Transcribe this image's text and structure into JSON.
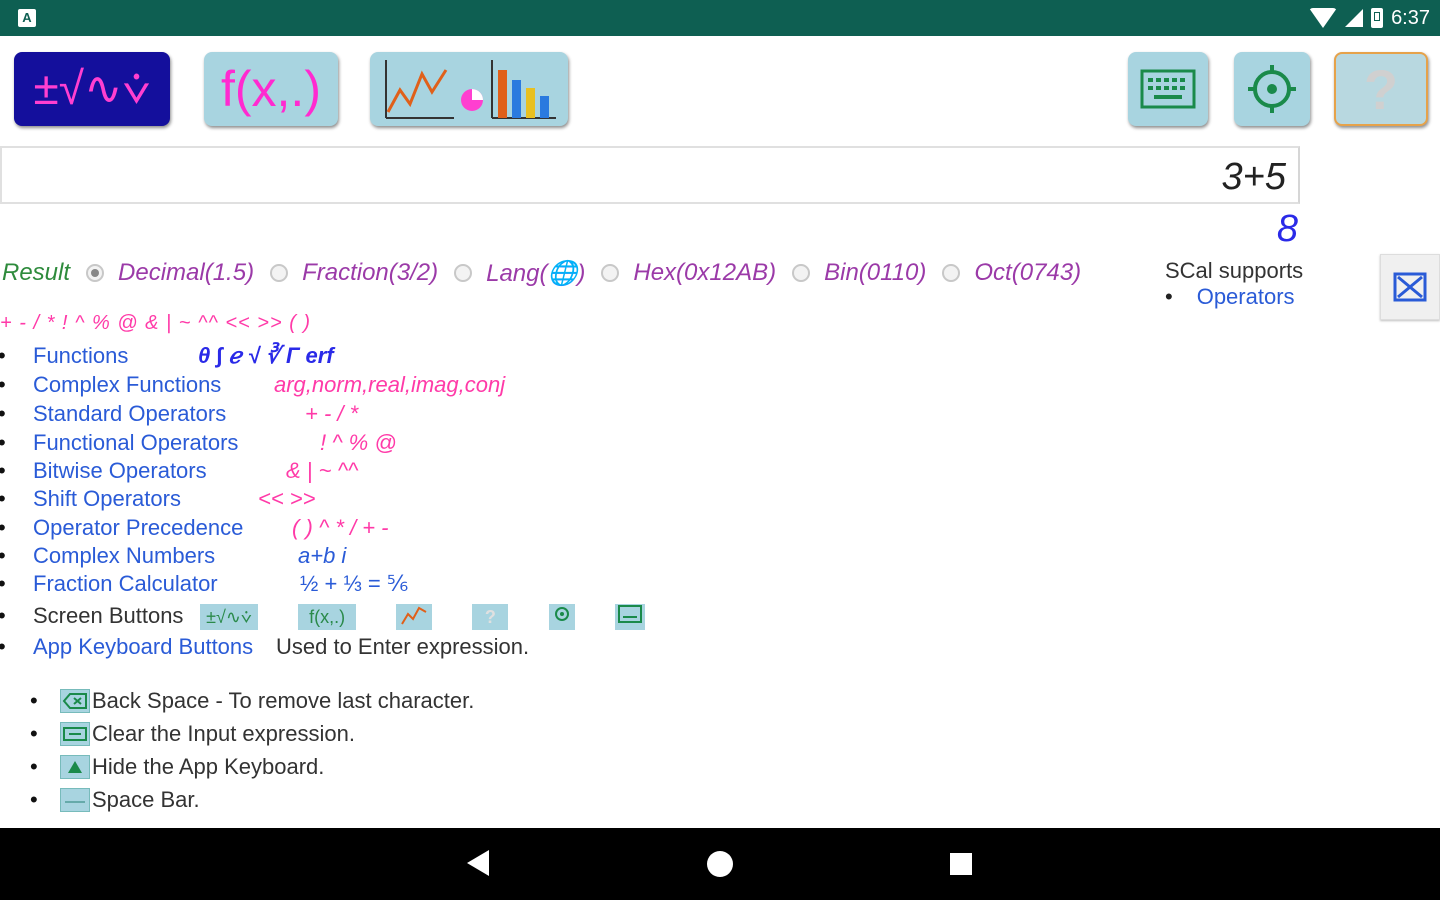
{
  "status": {
    "time": "6:37"
  },
  "toolbar": {
    "math_label": "±√∿⩒",
    "func_label": "f(x,.)",
    "help_label": "?"
  },
  "input": {
    "expression": "3+5"
  },
  "result": {
    "value": "8",
    "label": "Result",
    "options": [
      "Decimal(1.5)",
      "Fraction(3/2)",
      "Lang(🌐)",
      "Hex(0x12AB)",
      "Bin(0110)",
      "Oct(0743)"
    ]
  },
  "help": {
    "title": "SCal supports",
    "operators_link": "Operators",
    "ops_line": "+ - / * ! ^ % @ & | ~ ^^ << >> (    )",
    "items": [
      {
        "label": "Functions",
        "sample": "θ    ∫    ℯ    √ ∛    Γ    erf"
      },
      {
        "label": "Complex Functions",
        "sample": "arg,norm,real,imag,conj"
      },
      {
        "label": "Standard Operators",
        "sample": "+ - / *"
      },
      {
        "label": "Functional Operators",
        "sample": "! ^ % @"
      },
      {
        "label": "Bitwise Operators",
        "sample": "& | ~ ^^"
      },
      {
        "label": "Shift Operators",
        "sample": "<<    >>"
      },
      {
        "label": "Operator Precedence",
        "sample": "(    ) ^ * / + -"
      },
      {
        "label": "Complex Numbers",
        "sample": "a+b i"
      },
      {
        "label": "Fraction Calculator",
        "sample": "½ + ⅓ = ⅚"
      }
    ],
    "screen_buttons_label": "Screen Buttons",
    "screen_buttons": [
      "±√∿⩒",
      "f(x,.)"
    ],
    "app_keyboard_link": "App Keyboard Buttons",
    "app_keyboard_text": "Used to Enter expression.",
    "sub_items": [
      "Back Space - To remove last character.",
      "Clear the Input expression.",
      "Hide the App Keyboard.",
      "Space Bar."
    ]
  },
  "colors": {
    "status_bar": "#0e5f52",
    "toolbar_primary": "#140f9c",
    "toolbar_button": "#a8d4e0",
    "link": "#2a5bd7",
    "accent": "#ff3aa8"
  }
}
